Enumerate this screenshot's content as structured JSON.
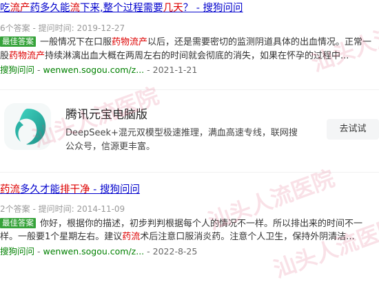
{
  "results": [
    {
      "title_parts": [
        {
          "t": "吃",
          "hl": false
        },
        {
          "t": "流产",
          "hl": true
        },
        {
          "t": "药多久能",
          "hl": false
        },
        {
          "t": "流",
          "hl": true
        },
        {
          "t": "下来,整个过程需要",
          "hl": false
        },
        {
          "t": "几天",
          "hl": true
        },
        {
          "t": "？ - 搜狗问问",
          "hl": false
        }
      ],
      "meta": "6个答案 - 提问时间: 2019-12-27",
      "badge": "最佳答案",
      "snippet_line1_parts": [
        {
          "t": "一般情况下在口服",
          "hl": false
        },
        {
          "t": "药物流产",
          "hl": true
        },
        {
          "t": "以后，还是需要密切的监测阴道具体的出血情况。正常一",
          "hl": false
        }
      ],
      "snippet_line2_parts": [
        {
          "t": "股",
          "hl": false
        },
        {
          "t": "药物流产",
          "hl": true
        },
        {
          "t": "持续淋漓出血大概在两周左右的时间就会彻底的消失，如果在怀孕的过程中...",
          "hl": false
        }
      ],
      "source_name": "搜狗问问",
      "source_url": "wenwen.sogou.com/z...",
      "source_date": "2021-1-21"
    },
    {
      "title_parts": [
        {
          "t": "药流",
          "hl": true
        },
        {
          "t": "多久才能",
          "hl": false
        },
        {
          "t": "排干净",
          "hl": true
        },
        {
          "t": " - 搜狗问问",
          "hl": false
        }
      ],
      "meta": "2个答案 - 提问时间: 2014-11-09",
      "badge": "最佳答案",
      "snippet_line1_parts": [
        {
          "t": "你好，根据你的描述，初步判判根据每个人的情况不一样。所以排出来的时间不一",
          "hl": false
        }
      ],
      "snippet_line2_parts": [
        {
          "t": "样。一般要1个星期左右。建议",
          "hl": false
        },
        {
          "t": "药流",
          "hl": true
        },
        {
          "t": "术后注意口服消炎药。注意个人卫生，保持外阴清洁...",
          "hl": false
        }
      ],
      "source_name": "搜狗问问",
      "source_url": "wenwen.sogou.com/z...",
      "source_date": "2022-8-25"
    }
  ],
  "ad": {
    "title": "腾讯元宝电脑版",
    "desc": "DeepSeek+混元双模型极速推理，满血高速专线，联网搜公众号，信源更丰富。",
    "button": "去试试",
    "icon": "yuanbao-logo"
  },
  "watermark": "汕头人流医院",
  "colors": {
    "link": "#0000cc",
    "highlight": "#dd0000",
    "source": "#008000",
    "badge": "#36a33a"
  }
}
